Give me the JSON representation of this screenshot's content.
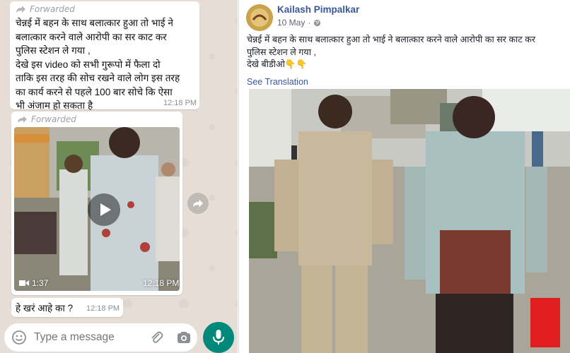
{
  "whatsapp": {
    "message1": {
      "forwarded_label": "Forwarded",
      "text": "चेन्नई में बहन के साथ बलात्कार हुआ तो भाई ने\nबलात्कार करने वाले आरोपी  का सर काट कर\nपुलिस स्टेशन ले गया ,\n देखे इस video को सभी गुरूपो में फैला दो\nताकि इस तरह की सोच रखने वाले लोग इस तरह\nका कार्य करने से पहले 100 बार सोचे कि ऐसा\nभी अंजाम हो सकता है",
      "time": "12:18 PM"
    },
    "message2": {
      "forwarded_label": "Forwarded",
      "video_duration": "1:37",
      "time": "12:18 PM"
    },
    "message3": {
      "text": "हे खरं आहे का ?",
      "time": "12:18 PM"
    },
    "input": {
      "placeholder": "Type a message"
    },
    "icons": [
      "forward-icon",
      "play-icon",
      "video-camera-icon",
      "share-forward-icon",
      "emoji-icon",
      "attach-icon",
      "camera-icon",
      "mic-icon"
    ]
  },
  "facebook": {
    "author": "Kailash Pimpalkar",
    "date": "10 May",
    "post_text": "चेन्नई में बहन के साथ बलात्कार हुआ तो भाई ने बलात्कार करने वाले आरोपी का सर काट कर\nपुलिस स्टेशन ले गया ,\nदेखे बीडीओ👇👇",
    "see_translation": "See Translation",
    "icons": [
      "globe-icon"
    ]
  },
  "colors": {
    "whatsapp_bg": "#e6ded6",
    "whatsapp_accent": "#00897b",
    "facebook_link": "#385898"
  }
}
